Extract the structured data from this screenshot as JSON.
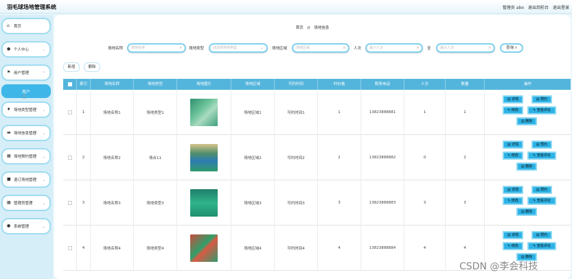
{
  "app": {
    "title": "羽毛球场地管理系统",
    "user_label": "管理员 abo",
    "to_frontend": "退出到前台",
    "logout": "退出登录"
  },
  "sidebar": {
    "items": [
      {
        "label": "首页",
        "icon": "home-icon"
      },
      {
        "label": "个人中心",
        "icon": "person-icon"
      },
      {
        "label": "用户管理",
        "icon": "flag-icon"
      },
      {
        "label": "场地类型管理",
        "icon": "pin-icon"
      },
      {
        "label": "场地信息管理",
        "icon": "card-icon"
      },
      {
        "label": "场地预约管理",
        "icon": "grid-icon"
      },
      {
        "label": "退订场地管理",
        "icon": "lock-icon"
      },
      {
        "label": "管理员管理",
        "icon": "grid-icon"
      },
      {
        "label": "系统管理",
        "icon": "person-icon"
      }
    ],
    "active_sub": "用户"
  },
  "breadcrumb": {
    "home": "首页",
    "sep": "//",
    "current": "场地信息"
  },
  "search": {
    "name_label": "场地名称",
    "name_placeholder": "场地名称",
    "type_label": "场地类型",
    "type_placeholder": "请选择场地类型",
    "area_label": "场地区域",
    "area_placeholder": "场地区域",
    "people_label": "人次",
    "min_placeholder": "最小人次",
    "to_label": "至",
    "max_placeholder": "最大人次",
    "query_label": "查询"
  },
  "actions": {
    "add": "新增",
    "delete": "删除"
  },
  "table": {
    "headers": [
      "索引",
      "场地名称",
      "场地类型",
      "场地图片",
      "场地区域",
      "可约时间",
      "时价格",
      "联系电话",
      "人次",
      "数量",
      "操作"
    ],
    "rows": [
      {
        "index": "1",
        "name": "场地名称1",
        "type": "场地类型1",
        "area": "场地区域1",
        "time": "可约时间1",
        "price": "1",
        "phone": "13823888881",
        "people": "1",
        "count": "1"
      },
      {
        "index": "2",
        "name": "场地名称2",
        "type": "场合11",
        "area": "场地区域2",
        "time": "可约时间2",
        "price": "2",
        "phone": "13823888882",
        "people": "0",
        "count": "2"
      },
      {
        "index": "3",
        "name": "场地名称3",
        "type": "场地类型3",
        "area": "场地区域3",
        "time": "可约时间3",
        "price": "3",
        "phone": "13823888883",
        "people": "3",
        "count": "3"
      },
      {
        "index": "4",
        "name": "场地名称4",
        "type": "场地类型4",
        "area": "场地区域4",
        "time": "可约时间4",
        "price": "4",
        "phone": "13823888884",
        "people": "4",
        "count": "4"
      }
    ],
    "row_ops": {
      "detail": "详情",
      "book": "预约",
      "edit": "修改",
      "reviews": "查看评论",
      "delete": "删除"
    }
  },
  "watermark": "CSDN @李会科技",
  "colors": {
    "accent": "#54b5dc",
    "button": "#2cb2e6",
    "sidebar_bg": "#d6eef8"
  }
}
